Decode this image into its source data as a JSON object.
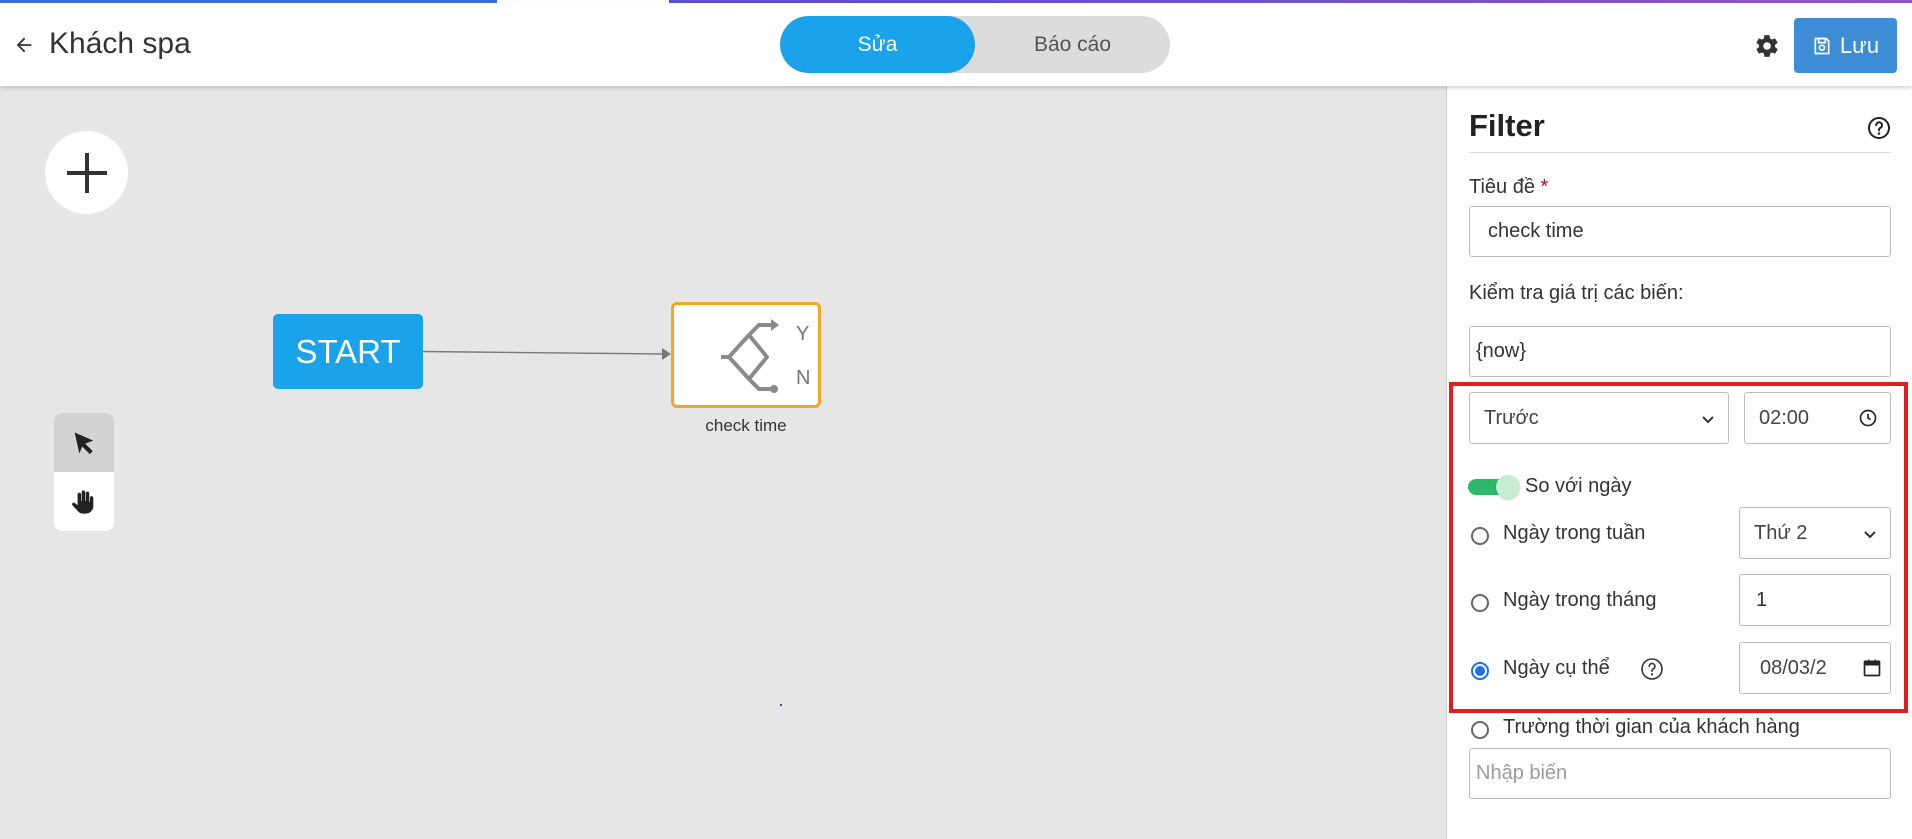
{
  "header": {
    "title": "Khách spa",
    "tabs": [
      {
        "label": "Sửa",
        "active": true
      },
      {
        "label": "Báo cáo",
        "active": false
      }
    ],
    "save_label": "Lưu",
    "icons": {
      "back": "arrow-left-icon",
      "settings": "gear-icon",
      "save": "floppy-disk-icon"
    }
  },
  "canvas": {
    "start_label": "START",
    "filter_node": {
      "yes": "Y",
      "no": "N",
      "caption": "check time",
      "icon": "branch-icon"
    },
    "tools": [
      "pointer-icon",
      "hand-icon"
    ],
    "add_icon": "plus-icon"
  },
  "panel": {
    "title": "Filter",
    "title_label": "Tiêu đề",
    "required_mark": "*",
    "title_value": "check time",
    "check_label": "Kiểm tra giá trị các biến:",
    "variable_value": "{now}",
    "compare_option": "Trước",
    "time_value": "02:00",
    "toggle_label": "So với ngày",
    "toggle_on": true,
    "weekday_label": "Ngày trong tuần",
    "weekday_value": "Thứ 2",
    "monthday_label": "Ngày trong tháng",
    "monthday_value": "1",
    "specific_label": "Ngày cụ thể",
    "date_value": "08/03/2",
    "customer_field_label": "Trường thời gian của khách hàng",
    "variable_placeholder": "Nhập biến",
    "selected_option": "specific"
  },
  "colors": {
    "accent": "#1aa3ea",
    "save": "#3d8cd6",
    "node_border": "#f5a623",
    "highlight": "#e11d1d",
    "toggle": "#2eb86b"
  }
}
